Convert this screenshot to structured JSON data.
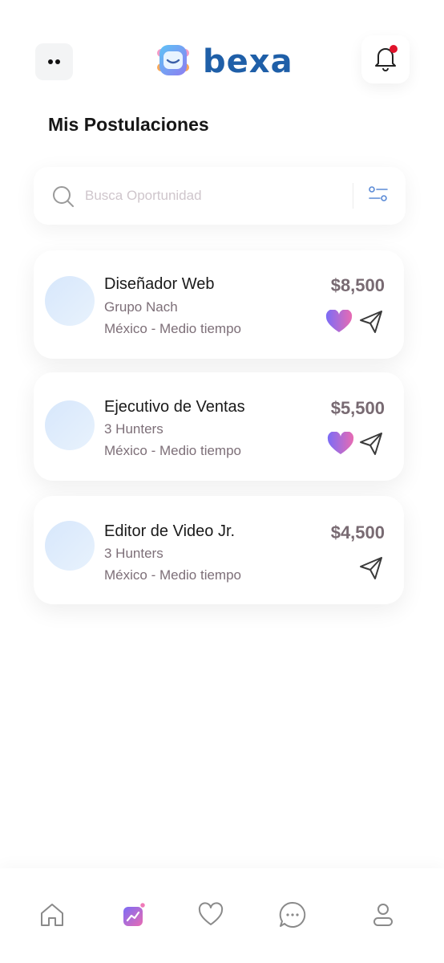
{
  "header": {
    "logo_text": "bexa",
    "notification_dot_color": "#e0122b"
  },
  "page": {
    "title": "Mis Postulaciones"
  },
  "search": {
    "placeholder": "Busca Oportunidad",
    "value": ""
  },
  "jobs": [
    {
      "title": "Diseñador Web",
      "company": "Grupo Nach",
      "location": "México - Medio tiempo",
      "salary": "$8,500",
      "favorite": true
    },
    {
      "title": "Ejecutivo de Ventas",
      "company": "3 Hunters",
      "location": "México - Medio tiempo",
      "salary": "$5,500",
      "favorite": true
    },
    {
      "title": "Editor de Video Jr.",
      "company": "3 Hunters",
      "location": "México - Medio tiempo",
      "salary": "$4,500",
      "favorite": false
    }
  ],
  "nav": {
    "items": [
      "home-icon",
      "stats-icon",
      "heart-icon",
      "chat-icon",
      "profile-icon"
    ],
    "active": "stats-icon"
  },
  "colors": {
    "brand_blue": "#1f5fa8",
    "heart_gradient_start": "#7b6cf6",
    "heart_gradient_end": "#e86bb2",
    "salary_text": "#786a72"
  }
}
